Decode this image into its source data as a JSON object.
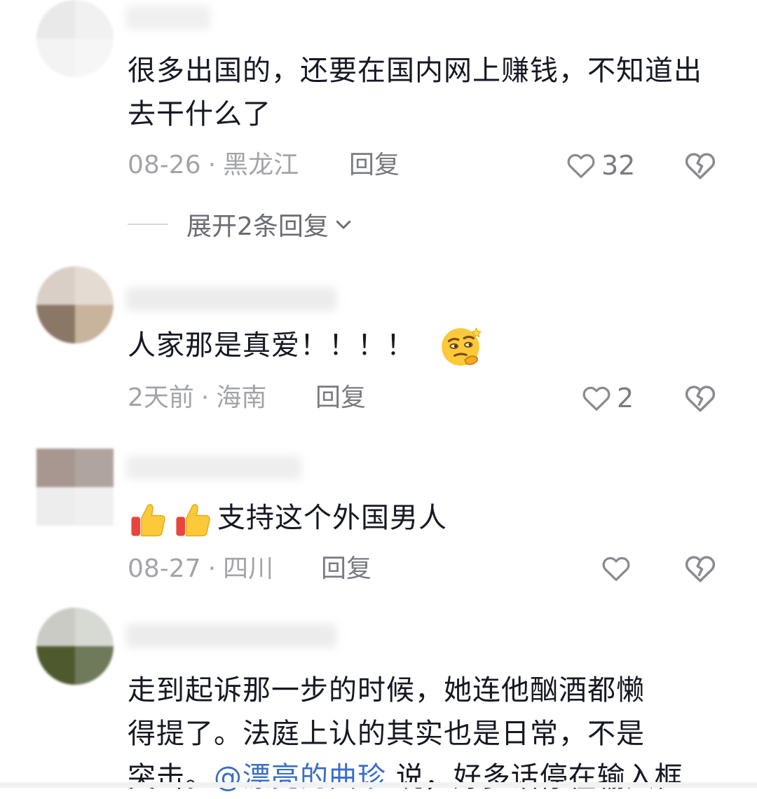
{
  "comments": [
    {
      "text": "很多出国的，还要在国内网上赚钱，不知道出去干什么了",
      "date": "08-26",
      "location": "黑龙江",
      "reply_label": "回复",
      "like_count": "32",
      "expand_label": "展开2条回复"
    },
    {
      "text": "人家那是真爱！！！！",
      "date": "2天前",
      "location": "海南",
      "reply_label": "回复",
      "like_count": "2"
    },
    {
      "text": "支持这个外国男人",
      "date": "08-27",
      "location": "四川",
      "reply_label": "回复",
      "like_count": ""
    },
    {
      "text_line1": "走到起诉那一步的时候，她连他酗酒都懒",
      "text_line2": "得提了。法庭上认的其实也是日常，不是",
      "text_line3_pre": "突击。",
      "mention": "@漂亮的曲珍",
      "text_line3_post": " 说，好多话停在输入框"
    }
  ],
  "meta_separator": "·",
  "icons": {
    "like": "heart-outline-icon",
    "dislike": "broken-heart-icon",
    "expand": "chevron-down-icon",
    "emoji_smirk": "smirk-thinking-emoji",
    "emoji_thumbs": "thumbs-up-emoji"
  },
  "colors": {
    "text": "#161823",
    "meta": "#a3a4a8",
    "mention": "#3a6ec6"
  }
}
